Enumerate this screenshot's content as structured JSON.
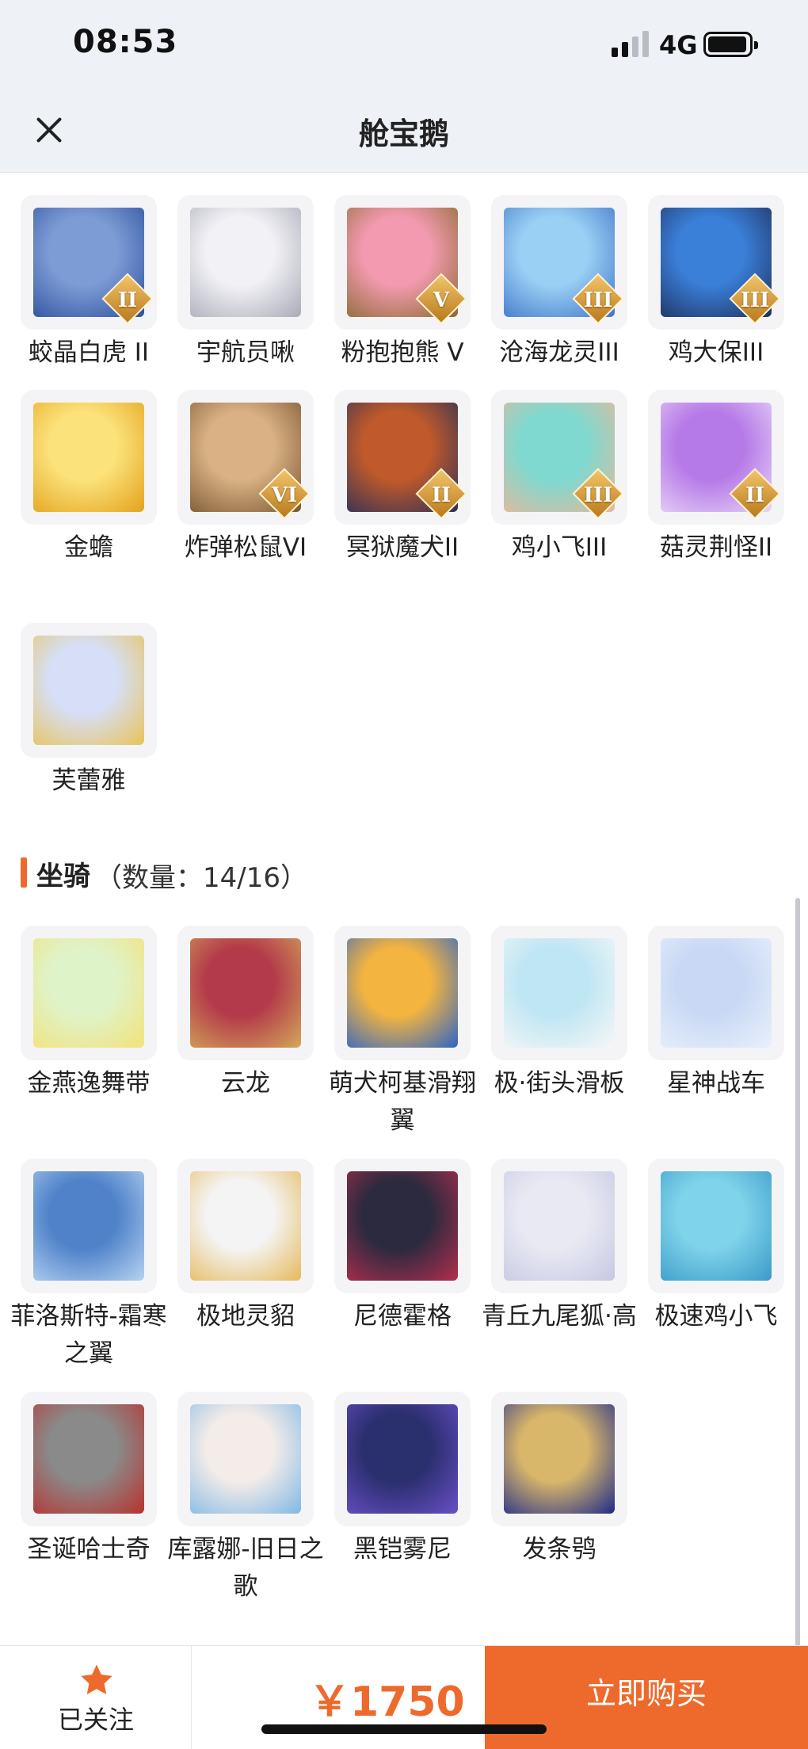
{
  "status": {
    "time": "08:53",
    "network": "4G"
  },
  "nav": {
    "title": "舱宝鹅"
  },
  "pets": [
    {
      "name": "蛟晶白虎 II",
      "badge": "II",
      "icon": "white-tiger-icon",
      "colors": [
        "#7d9cd6",
        "#2c4f9a"
      ]
    },
    {
      "name": "宇航员啾",
      "badge": "",
      "icon": "astronaut-bird-icon",
      "colors": [
        "#f2f2f6",
        "#a9abb6"
      ]
    },
    {
      "name": "粉抱抱熊 V",
      "badge": "V",
      "icon": "pink-bear-icon",
      "colors": [
        "#f39ab0",
        "#8a6a2e"
      ]
    },
    {
      "name": "沧海龙灵III",
      "badge": "III",
      "icon": "dragon-spirit-icon",
      "colors": [
        "#9bd0f5",
        "#3e74c8"
      ]
    },
    {
      "name": "鸡大保III",
      "badge": "III",
      "icon": "blue-chicken-icon",
      "colors": [
        "#3a7fd8",
        "#1e2f5c"
      ]
    },
    {
      "name": "金蟾",
      "badge": "",
      "icon": "golden-toad-icon",
      "colors": [
        "#fbe27a",
        "#e3a21d"
      ]
    },
    {
      "name": "炸弹松鼠VI",
      "badge": "VI",
      "icon": "bomb-squirrel-icon",
      "colors": [
        "#d9b184",
        "#7a5530"
      ]
    },
    {
      "name": "冥狱魔犬II",
      "badge": "II",
      "icon": "hell-hound-icon",
      "colors": [
        "#c05a2a",
        "#2a2f58"
      ]
    },
    {
      "name": "鸡小飞III",
      "badge": "III",
      "icon": "chick-fly-icon",
      "colors": [
        "#7fd9d0",
        "#e8b89a"
      ]
    },
    {
      "name": "菇灵荆怪II",
      "badge": "II",
      "icon": "mushroom-spirit-icon",
      "colors": [
        "#b67ae8",
        "#e9d6f7"
      ]
    },
    {
      "name": "芙蕾雅",
      "badge": "",
      "icon": "freya-icon",
      "colors": [
        "#d6dff7",
        "#e9c357"
      ]
    }
  ],
  "mounts_section": {
    "title": "坐骑",
    "count": "（数量：14/16）"
  },
  "mounts": [
    {
      "name": "金燕逸舞带",
      "icon": "golden-swallow-ribbon-icon",
      "colors": [
        "#dff3c8",
        "#f3e27a"
      ]
    },
    {
      "name": "云龙",
      "icon": "cloud-dragon-icon",
      "colors": [
        "#b33a4a",
        "#d3a85a"
      ]
    },
    {
      "name": "萌犬柯基滑翔翼",
      "icon": "corgi-glider-icon",
      "colors": [
        "#f3b440",
        "#2c64c8"
      ]
    },
    {
      "name": "极·街头滑板",
      "icon": "street-skateboard-icon",
      "colors": [
        "#bfe6f3",
        "#f7f7f7"
      ]
    },
    {
      "name": "星神战车",
      "icon": "star-chariot-icon",
      "colors": [
        "#c9d9f5",
        "#e9f0fb"
      ]
    },
    {
      "name": "菲洛斯特-霜寒之翼",
      "icon": "frost-wing-icon",
      "colors": [
        "#4f82c9",
        "#b6d4f2"
      ]
    },
    {
      "name": "极地灵貂",
      "icon": "polar-marten-icon",
      "colors": [
        "#f4f4f4",
        "#e6b95a"
      ]
    },
    {
      "name": "尼德霍格",
      "icon": "nidhogg-icon",
      "colors": [
        "#2b2a3f",
        "#b32e4e"
      ]
    },
    {
      "name": "青丘九尾狐·高",
      "icon": "nine-tail-fox-icon",
      "colors": [
        "#e9e9f4",
        "#c6c8e2"
      ]
    },
    {
      "name": "极速鸡小飞",
      "icon": "speed-chick-icon",
      "colors": [
        "#7fd3ea",
        "#3a9ac8"
      ]
    },
    {
      "name": "圣诞哈士奇",
      "icon": "christmas-husky-icon",
      "colors": [
        "#8a8a8a",
        "#b8322e"
      ]
    },
    {
      "name": "库露娜-旧日之歌",
      "icon": "kuluna-song-icon",
      "colors": [
        "#f4ece8",
        "#7fb8e6"
      ]
    },
    {
      "name": "黑铠雾尼",
      "icon": "black-armor-unicorn-icon",
      "colors": [
        "#2a2f6e",
        "#6a4fc8"
      ]
    },
    {
      "name": "发条鸮",
      "icon": "clockwork-owl-icon",
      "colors": [
        "#d8b66a",
        "#1e2a8a"
      ]
    }
  ],
  "bottom": {
    "follow_label": "已关注",
    "price": "￥1750",
    "buy_label": "立即购买"
  },
  "accent": "#ee6a2c"
}
